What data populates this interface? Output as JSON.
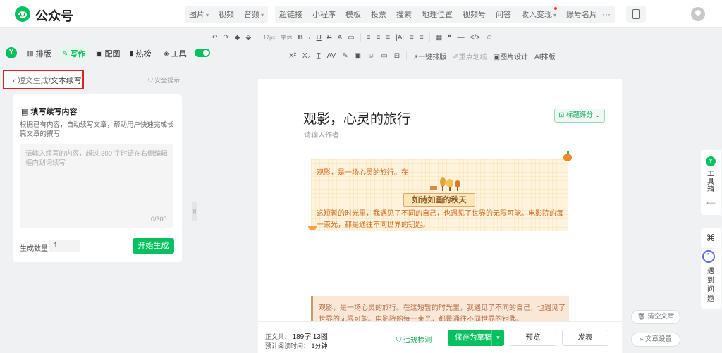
{
  "header": {
    "brand": "公众号",
    "menu_group1": [
      "图片",
      "视频",
      "音频"
    ],
    "menu_group2": [
      "超链接",
      "小程序",
      "模板",
      "投票",
      "搜索",
      "地理位置",
      "视频号",
      "问答",
      "收入变现",
      "账号名片"
    ],
    "more": "···"
  },
  "toolbar1": [
    "↶",
    "↷",
    "◆",
    "⬙",
    "17px",
    "字体",
    "B",
    "I",
    "U",
    "S",
    "A",
    "▭",
    "≡",
    "≡",
    "≡",
    "|A|",
    "≡",
    "≡",
    "▦",
    "❝",
    "—",
    "</>",
    "☺"
  ],
  "toolbar2": [
    "X²",
    "X₂",
    "T̲",
    "AV",
    "✎",
    "▣",
    "☺",
    "▭",
    "⊡",
    "一键排版",
    "重点划线",
    "图片设计",
    "AI排版"
  ],
  "nav": {
    "tabs": [
      "排版",
      "写作",
      "配图",
      "热榜",
      "工具"
    ],
    "icons": [
      "layout-icon",
      "pen-icon",
      "image-icon",
      "bookmark-icon",
      "cube-icon"
    ]
  },
  "left_panel": {
    "breadcrumb_back": "短文生成",
    "breadcrumb_current": "/文本续写",
    "safety": "安全提示",
    "title": "填写续写内容",
    "description": "根据已有内容，自动续写文章，帮助用户快速完成长篇文章的撰写",
    "textarea_placeholder": "请输入续写的内容，超过 300 字时请在右侧编辑框内划词续写",
    "counter": "0/300",
    "quantity_label": "生成数量：",
    "quantity_value": "1",
    "generate_button": "开始生成"
  },
  "article": {
    "title": "观影，心灵的旅行",
    "author_placeholder": "请输入作者",
    "score_button": "标题评分",
    "card1_p1": "观影，是一场心灵的旅行。在",
    "card1_badge": "如诗如画的秋天",
    "card1_p2": "这短暂的时光里，我遇见了不同的自己，也遇见了世界的无限可能。电影院的每一束光，都是通往不同世界的钥匙。",
    "card2_text": "观影，是一场心灵的旅行。在这短暂的时光里，我遇见了不同的自己，也遇见了世界的无限可能。电影院的每一束光，都是通往不同世界的钥匙。"
  },
  "bottom": {
    "stats_label": "正文共：",
    "char_count": "189字",
    "image_count": "13图",
    "read_label": "预计阅读时间：",
    "read_time": "1分钟",
    "check": "违规检测",
    "save": "保存为草稿",
    "preview": "预览",
    "publish": "发表"
  },
  "right": {
    "toolbox_label": "工具箱",
    "help_label": "遇到问题",
    "clear": "清空文章",
    "settings": "文章设置"
  },
  "colors": {
    "accent": "#07c160",
    "highlight_border": "#e02020",
    "card_text": "#d2691e"
  }
}
